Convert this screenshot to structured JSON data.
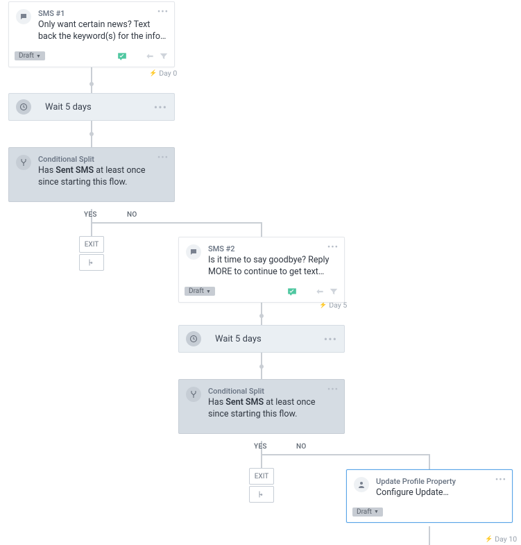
{
  "sms1": {
    "title": "SMS #1",
    "text": "Only want certain news? Text back the keyword(s) for the info…",
    "status": "Draft"
  },
  "wait1": {
    "text": "Wait 5 days"
  },
  "cond1": {
    "title": "Conditional Split",
    "prefix": "Has ",
    "bold": "Sent SMS",
    "suffix": " at least once since starting this flow."
  },
  "labels": {
    "yes1": "YES",
    "no1": "NO",
    "exit1": "EXIT",
    "yes2": "YES",
    "no2": "NO",
    "exit2": "EXIT"
  },
  "day0": "Day 0",
  "day5": "Day 5",
  "day10": "Day 10",
  "sms2": {
    "title": "SMS #2",
    "text": "Is it time to say goodbye? Reply MORE to continue to get text…",
    "status": "Draft"
  },
  "wait2": {
    "text": "Wait 5 days"
  },
  "cond2": {
    "title": "Conditional Split",
    "prefix": "Has ",
    "bold": "Sent SMS",
    "suffix": " at least once since starting this flow."
  },
  "update": {
    "title": "Update Profile Property",
    "text": "Configure Update…",
    "status": "Draft"
  }
}
